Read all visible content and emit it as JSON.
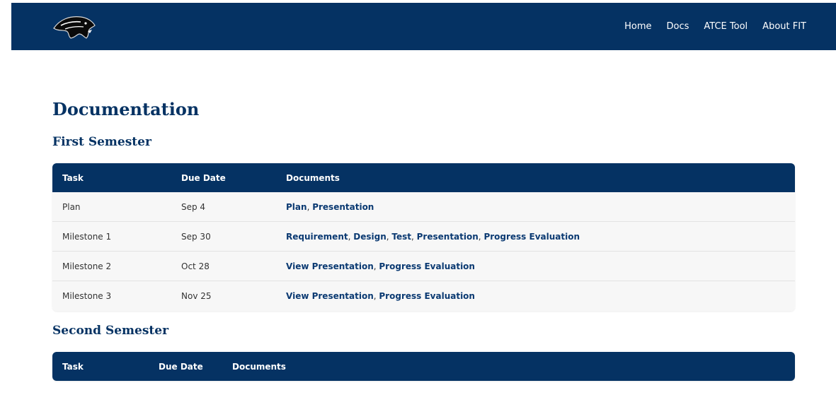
{
  "nav": {
    "logo": "panther-logo",
    "links": [
      "Home",
      "Docs",
      "ATCE Tool",
      "About FIT"
    ]
  },
  "page": {
    "title": "Documentation"
  },
  "first_semester": {
    "title": "First Semester",
    "headers": [
      "Task",
      "Due Date",
      "Documents"
    ],
    "rows": [
      {
        "task": "Plan",
        "due": "Sep 4",
        "docs": [
          "Plan",
          "Presentation"
        ]
      },
      {
        "task": "Milestone 1",
        "due": "Sep 30",
        "docs": [
          "Requirement",
          "Design",
          "Test",
          "Presentation",
          "Progress Evaluation"
        ]
      },
      {
        "task": "Milestone 2",
        "due": "Oct 28",
        "docs": [
          "View Presentation",
          "Progress Evaluation"
        ]
      },
      {
        "task": "Milestone 3",
        "due": "Nov 25",
        "docs": [
          "View Presentation",
          "Progress Evaluation"
        ]
      }
    ]
  },
  "second_semester": {
    "title": "Second Semester",
    "headers": [
      "Task",
      "Due Date",
      "Documents"
    ]
  },
  "colors": {
    "brand": "#053263",
    "link": "#0b3a72",
    "row_bg": "#f7f7f7"
  }
}
